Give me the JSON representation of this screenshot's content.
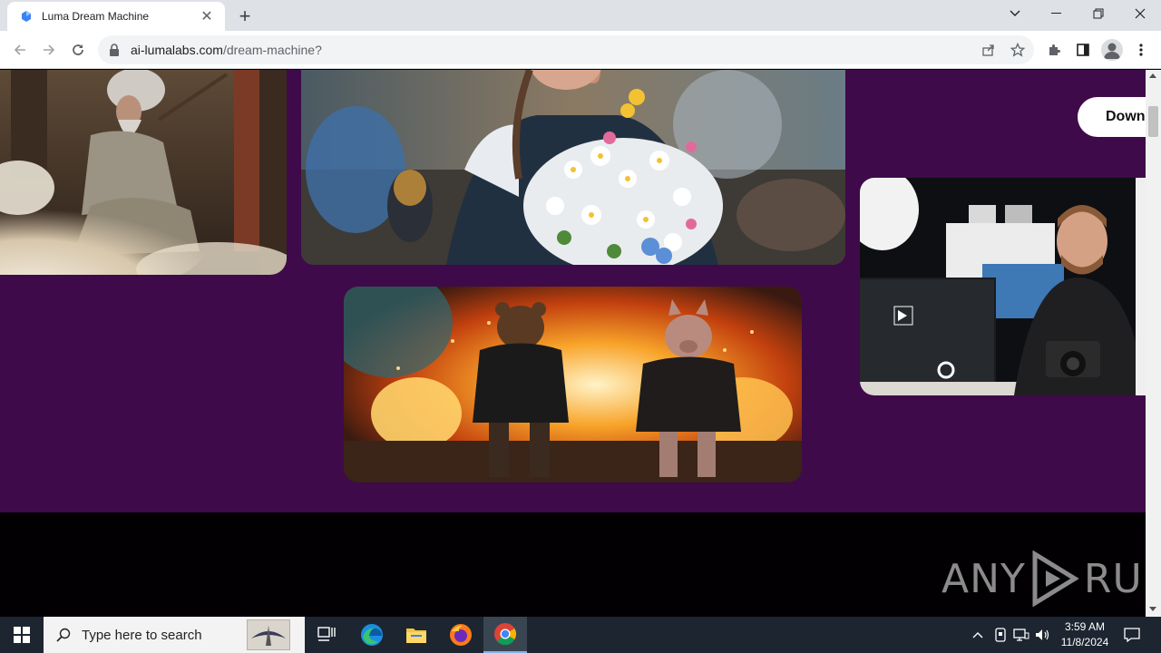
{
  "browser": {
    "tab_title": "Luma Dream Machine",
    "new_tab_glyph": "+",
    "close_glyph": "✕",
    "url_host": "ai-lumalabs.com",
    "url_path": "/dream-machine?",
    "window_controls": {
      "minimize": "—",
      "restore": "❐",
      "close": "✕",
      "tabsearch": "⌄"
    }
  },
  "page": {
    "background_color": "#3f0a4a",
    "footer_color": "#020003",
    "download_button_label": "Down",
    "media": [
      {
        "name": "old-sage-with-staff-image",
        "description_icon": "image"
      },
      {
        "name": "woman-with-flower-bouquet-image",
        "description_icon": "image"
      },
      {
        "name": "bear-and-pig-in-explosion-image",
        "description_icon": "image"
      },
      {
        "name": "photographer-at-desk-image",
        "description_icon": "image"
      }
    ]
  },
  "watermark": {
    "left": "ANY",
    "right": "RUN"
  },
  "taskbar": {
    "search_placeholder": "Type here to search",
    "time": "3:59 AM",
    "date": "11/8/2024"
  }
}
